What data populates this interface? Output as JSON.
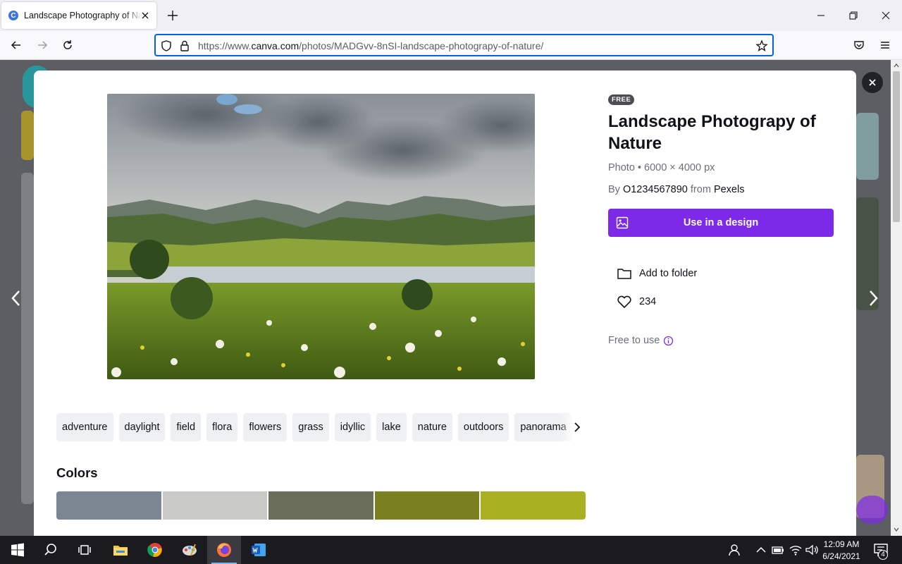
{
  "browser": {
    "tab_title": "Landscape Photography of Nature",
    "favicon_letter": "C",
    "url_prefix": "https://www.",
    "url_domain": "canva.com",
    "url_path": "/photos/MADGvv-8nSI-landscape-photograpy-of-nature/"
  },
  "modal": {
    "badge": "FREE",
    "title": "Landscape Photograpy of Nature",
    "meta": "Photo • 6000 × 4000 px",
    "by_prefix": "By ",
    "author": "O1234567890",
    "from_text": " from ",
    "source": "Pexels",
    "use_button": "Use in a design",
    "add_folder": "Add to folder",
    "likes": "234",
    "free_to_use": "Free to use",
    "tags": [
      "adventure",
      "daylight",
      "field",
      "flora",
      "flowers",
      "grass",
      "idyllic",
      "lake",
      "nature",
      "outdoors",
      "panorama"
    ],
    "colors_heading": "Colors",
    "colors": [
      "#7c8592",
      "#c9c9c5",
      "#6b6e5b",
      "#7a7f22",
      "#a9b122"
    ],
    "accent": "#7d2ae8"
  },
  "taskbar": {
    "time": "12:09 AM",
    "date": "6/24/2021",
    "notifications": "4"
  }
}
